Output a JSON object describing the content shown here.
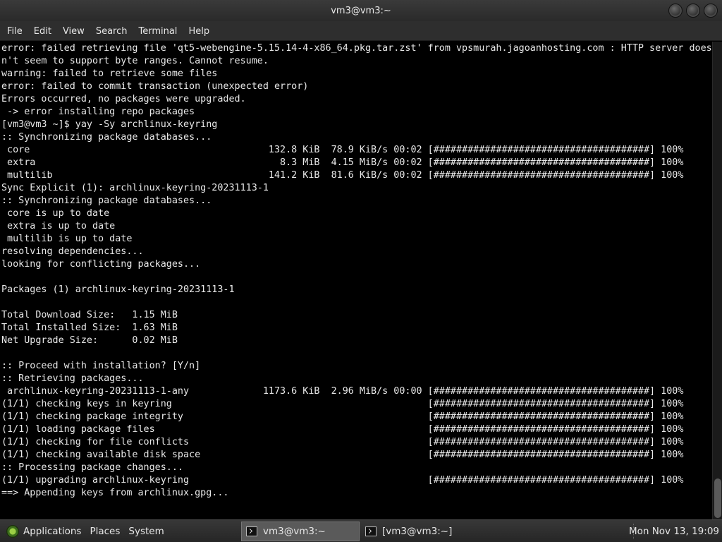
{
  "window": {
    "title": "vm3@vm3:~"
  },
  "menubar": {
    "items": [
      "File",
      "Edit",
      "View",
      "Search",
      "Terminal",
      "Help"
    ]
  },
  "terminal": {
    "lines": [
      "error: failed retrieving file 'qt5-webengine-5.15.14-4-x86_64.pkg.tar.zst' from vpsmurah.jagoanhosting.com : HTTP server does",
      "n't seem to support byte ranges. Cannot resume.",
      "warning: failed to retrieve some files",
      "error: failed to commit transaction (unexpected error)",
      "Errors occurred, no packages were upgraded.",
      " -> error installing repo packages",
      "[vm3@vm3 ~]$ yay -Sy archlinux-keyring",
      ":: Synchronizing package databases...",
      " core                                          132.8 KiB  78.9 KiB/s 00:02 [######################################] 100%",
      " extra                                           8.3 MiB  4.15 MiB/s 00:02 [######################################] 100%",
      " multilib                                      141.2 KiB  81.6 KiB/s 00:02 [######################################] 100%",
      "Sync Explicit (1): archlinux-keyring-20231113-1",
      ":: Synchronizing package databases...",
      " core is up to date",
      " extra is up to date",
      " multilib is up to date",
      "resolving dependencies...",
      "looking for conflicting packages...",
      "",
      "Packages (1) archlinux-keyring-20231113-1",
      "",
      "Total Download Size:   1.15 MiB",
      "Total Installed Size:  1.63 MiB",
      "Net Upgrade Size:      0.02 MiB",
      "",
      ":: Proceed with installation? [Y/n]",
      ":: Retrieving packages...",
      " archlinux-keyring-20231113-1-any             1173.6 KiB  2.96 MiB/s 00:00 [######################################] 100%",
      "(1/1) checking keys in keyring                                             [######################################] 100%",
      "(1/1) checking package integrity                                           [######################################] 100%",
      "(1/1) loading package files                                                [######################################] 100%",
      "(1/1) checking for file conflicts                                          [######################################] 100%",
      "(1/1) checking available disk space                                        [######################################] 100%",
      ":: Processing package changes...",
      "(1/1) upgrading archlinux-keyring                                          [######################################] 100%",
      "==> Appending keys from archlinux.gpg..."
    ]
  },
  "taskbar": {
    "applications": "Applications",
    "places": "Places",
    "system": "System",
    "tasks": [
      "vm3@vm3:~",
      "[vm3@vm3:~]"
    ],
    "clock": "Mon Nov 13, 19:09"
  },
  "colors": {
    "terminal_bg": "#000000",
    "terminal_fg": "#e8e8e8",
    "panel": "#2e2e2e"
  }
}
